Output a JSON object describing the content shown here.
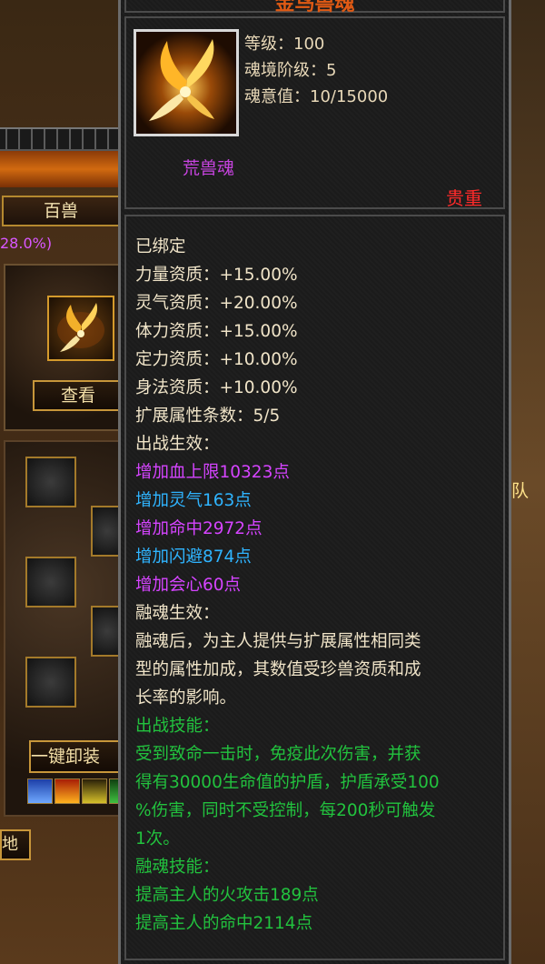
{
  "background": {
    "tab_label": "百兽",
    "pct_text": "28.0%)",
    "view_button": "查看",
    "unload_button": "一键卸装",
    "land_button": "地",
    "right_fragment": "队"
  },
  "tooltip": {
    "title": "金鸟兽魂",
    "stats": [
      {
        "label": "等级：",
        "value": "100"
      },
      {
        "label": "魂境阶级：",
        "value": "5"
      },
      {
        "label": "魂意值：",
        "value": "10/15000"
      }
    ],
    "type": "荒兽魂",
    "rarity": "贵重",
    "lines": [
      {
        "text": "已绑定",
        "color": "cream"
      },
      {
        "text": "力量资质：+15.00%",
        "color": "cream"
      },
      {
        "text": "灵气资质：+20.00%",
        "color": "cream"
      },
      {
        "text": "体力资质：+15.00%",
        "color": "cream"
      },
      {
        "text": "定力资质：+10.00%",
        "color": "cream"
      },
      {
        "text": "身法资质：+10.00%",
        "color": "cream"
      },
      {
        "text": "扩展属性条数：5/5",
        "color": "cream"
      },
      {
        "text": "出战生效：",
        "color": "cream"
      },
      {
        "text": "增加血上限10323点",
        "color": "purple"
      },
      {
        "text": "增加灵气163点",
        "color": "blue"
      },
      {
        "text": "增加命中2972点",
        "color": "purple"
      },
      {
        "text": "增加闪避874点",
        "color": "blue"
      },
      {
        "text": "增加会心60点",
        "color": "purple"
      },
      {
        "text": "融魂生效：",
        "color": "cream"
      },
      {
        "text": "融魂后，为主人提供与扩展属性相同类",
        "color": "cream"
      },
      {
        "text": "型的属性加成，其数值受珍兽资质和成",
        "color": "cream"
      },
      {
        "text": "长率的影响。",
        "color": "cream"
      },
      {
        "text": "出战技能：",
        "color": "green"
      },
      {
        "text": "受到致命一击时，免疫此次伤害，并获",
        "color": "green"
      },
      {
        "text": "得有30000生命值的护盾，护盾承受100",
        "color": "green"
      },
      {
        "text": "%伤害，同时不受控制，每200秒可触发",
        "color": "green"
      },
      {
        "text": "1次。",
        "color": "green"
      },
      {
        "text": "融魂技能：",
        "color": "green"
      },
      {
        "text": "提高主人的火攻击189点",
        "color": "green"
      },
      {
        "text": "提高主人的命中2114点",
        "color": "green"
      }
    ]
  },
  "colors": {
    "cream": "#f0e4c8",
    "purple": "#d544ff",
    "blue": "#2fb4ff",
    "green": "#22c23e",
    "rarity_red": "#ff2a2a",
    "title_orange": "#e05a14"
  },
  "icons": {
    "pet_item": "golden-wing-soul-icon"
  }
}
